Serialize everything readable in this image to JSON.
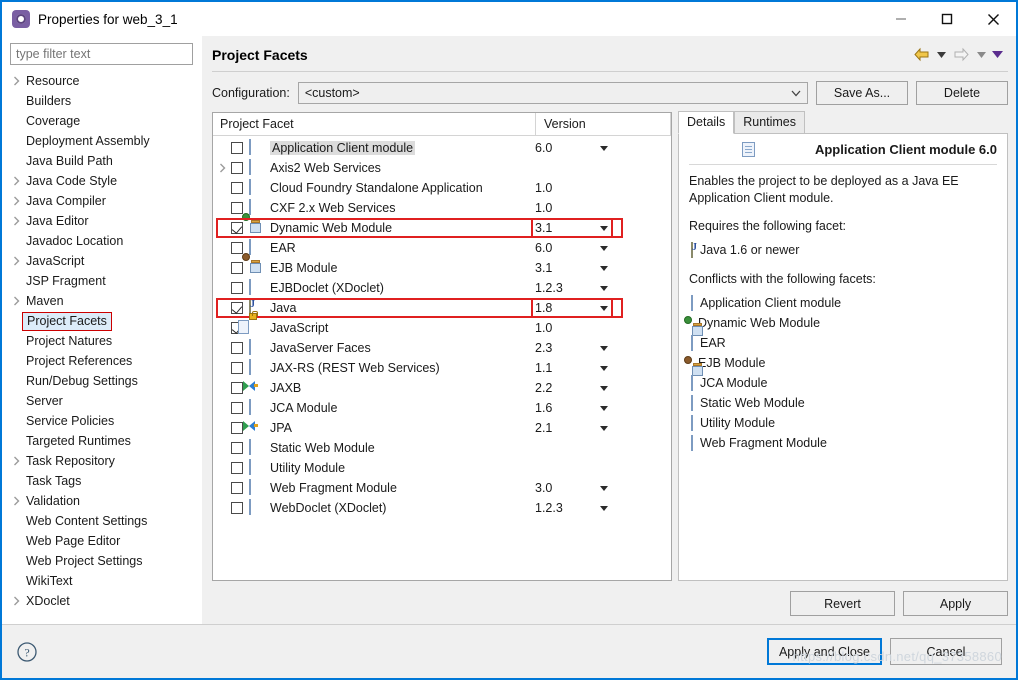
{
  "window": {
    "title": "Properties for web_3_1",
    "icon": "properties-gear-icon",
    "minimize_label": "Minimize",
    "maximize_label": "Maximize",
    "close_label": "Close"
  },
  "sidebar": {
    "filter_placeholder": "type filter text",
    "items": [
      {
        "label": "Resource",
        "expandable": true
      },
      {
        "label": "Builders",
        "expandable": false
      },
      {
        "label": "Coverage",
        "expandable": false
      },
      {
        "label": "Deployment Assembly",
        "expandable": false
      },
      {
        "label": "Java Build Path",
        "expandable": false
      },
      {
        "label": "Java Code Style",
        "expandable": true
      },
      {
        "label": "Java Compiler",
        "expandable": true
      },
      {
        "label": "Java Editor",
        "expandable": true
      },
      {
        "label": "Javadoc Location",
        "expandable": false
      },
      {
        "label": "JavaScript",
        "expandable": true
      },
      {
        "label": "JSP Fragment",
        "expandable": false
      },
      {
        "label": "Maven",
        "expandable": true
      },
      {
        "label": "Project Facets",
        "expandable": false,
        "selected": true
      },
      {
        "label": "Project Natures",
        "expandable": false
      },
      {
        "label": "Project References",
        "expandable": false
      },
      {
        "label": "Run/Debug Settings",
        "expandable": false
      },
      {
        "label": "Server",
        "expandable": false
      },
      {
        "label": "Service Policies",
        "expandable": false
      },
      {
        "label": "Targeted Runtimes",
        "expandable": false
      },
      {
        "label": "Task Repository",
        "expandable": true
      },
      {
        "label": "Task Tags",
        "expandable": false
      },
      {
        "label": "Validation",
        "expandable": true
      },
      {
        "label": "Web Content Settings",
        "expandable": false
      },
      {
        "label": "Web Page Editor",
        "expandable": false
      },
      {
        "label": "Web Project Settings",
        "expandable": false
      },
      {
        "label": "WikiText",
        "expandable": false
      },
      {
        "label": "XDoclet",
        "expandable": true
      }
    ]
  },
  "page": {
    "title": "Project Facets",
    "back_label": "Back",
    "forward_label": "Forward",
    "menu_label": "View Menu"
  },
  "configuration": {
    "label": "Configuration:",
    "value": "<custom>",
    "save_as_label": "Save As...",
    "delete_label": "Delete"
  },
  "facets_table": {
    "columns": [
      "Project Facet",
      "Version"
    ],
    "rows": [
      {
        "name": "Application Client module",
        "version": "6.0",
        "checked": false,
        "icon": "doc",
        "dropdown": true,
        "expandable": false,
        "highlighted_name": true
      },
      {
        "name": "Axis2 Web Services",
        "version": "",
        "checked": false,
        "icon": "doc",
        "dropdown": false,
        "expandable": true
      },
      {
        "name": "Cloud Foundry Standalone Application",
        "version": "1.0",
        "checked": false,
        "icon": "doc",
        "dropdown": false,
        "expandable": false
      },
      {
        "name": "CXF 2.x Web Services",
        "version": "1.0",
        "checked": false,
        "icon": "doc",
        "dropdown": false,
        "expandable": false
      },
      {
        "name": "Dynamic Web Module",
        "version": "3.1",
        "checked": true,
        "icon": "jar-green",
        "dropdown": true,
        "expandable": false,
        "outlined": true
      },
      {
        "name": "EAR",
        "version": "6.0",
        "checked": false,
        "icon": "doc",
        "dropdown": true,
        "expandable": false
      },
      {
        "name": "EJB Module",
        "version": "3.1",
        "checked": false,
        "icon": "jar-brown",
        "dropdown": true,
        "expandable": false
      },
      {
        "name": "EJBDoclet (XDoclet)",
        "version": "1.2.3",
        "checked": false,
        "icon": "doc",
        "dropdown": true,
        "expandable": false
      },
      {
        "name": "Java",
        "version": "1.8",
        "checked": true,
        "icon": "java",
        "dropdown": true,
        "expandable": false,
        "outlined": true
      },
      {
        "name": "JavaScript",
        "version": "1.0",
        "checked": true,
        "icon": "js-lock",
        "dropdown": false,
        "expandable": false
      },
      {
        "name": "JavaServer Faces",
        "version": "2.3",
        "checked": false,
        "icon": "doc",
        "dropdown": true,
        "expandable": false
      },
      {
        "name": "JAX-RS (REST Web Services)",
        "version": "1.1",
        "checked": false,
        "icon": "doc",
        "dropdown": true,
        "expandable": false
      },
      {
        "name": "JAXB",
        "version": "2.2",
        "checked": false,
        "icon": "xml",
        "dropdown": true,
        "expandable": false
      },
      {
        "name": "JCA Module",
        "version": "1.6",
        "checked": false,
        "icon": "doc",
        "dropdown": true,
        "expandable": false
      },
      {
        "name": "JPA",
        "version": "2.1",
        "checked": false,
        "icon": "xml",
        "dropdown": true,
        "expandable": false
      },
      {
        "name": "Static Web Module",
        "version": "",
        "checked": false,
        "icon": "doc",
        "dropdown": false,
        "expandable": false
      },
      {
        "name": "Utility Module",
        "version": "",
        "checked": false,
        "icon": "doc",
        "dropdown": false,
        "expandable": false
      },
      {
        "name": "Web Fragment Module",
        "version": "3.0",
        "checked": false,
        "icon": "doc",
        "dropdown": true,
        "expandable": false
      },
      {
        "name": "WebDoclet (XDoclet)",
        "version": "1.2.3",
        "checked": false,
        "icon": "doc",
        "dropdown": true,
        "expandable": false
      }
    ]
  },
  "details": {
    "tabs": [
      {
        "label": "Details",
        "active": true
      },
      {
        "label": "Runtimes",
        "active": false
      }
    ],
    "heading": "Application Client module 6.0",
    "description": "Enables the project to be deployed as a Java EE Application Client module.",
    "requires_label": "Requires the following facet:",
    "requires": [
      {
        "label": "Java 1.6 or newer",
        "icon": "java"
      }
    ],
    "conflicts_label": "Conflicts with the following facets:",
    "conflicts": [
      {
        "label": "Application Client module",
        "icon": "doc"
      },
      {
        "label": "Dynamic Web Module",
        "icon": "jar-green"
      },
      {
        "label": "EAR",
        "icon": "doc"
      },
      {
        "label": "EJB Module",
        "icon": "jar-brown"
      },
      {
        "label": "JCA Module",
        "icon": "doc"
      },
      {
        "label": "Static Web Module",
        "icon": "doc"
      },
      {
        "label": "Utility Module",
        "icon": "doc"
      },
      {
        "label": "Web Fragment Module",
        "icon": "doc"
      }
    ]
  },
  "pane_buttons": {
    "revert_label": "Revert",
    "apply_label": "Apply"
  },
  "footer": {
    "help_label": "Help",
    "apply_and_close_label": "Apply and Close",
    "cancel_label": "Cancel",
    "watermark": "https://blog.csdn.net/qq_37358860"
  },
  "colors": {
    "accent": "#0078d7",
    "highlight_outline": "#e02020",
    "selection": "#dcecf9",
    "back_arrow": "#e8a72a",
    "menu_arrow": "#5b2d8e"
  }
}
